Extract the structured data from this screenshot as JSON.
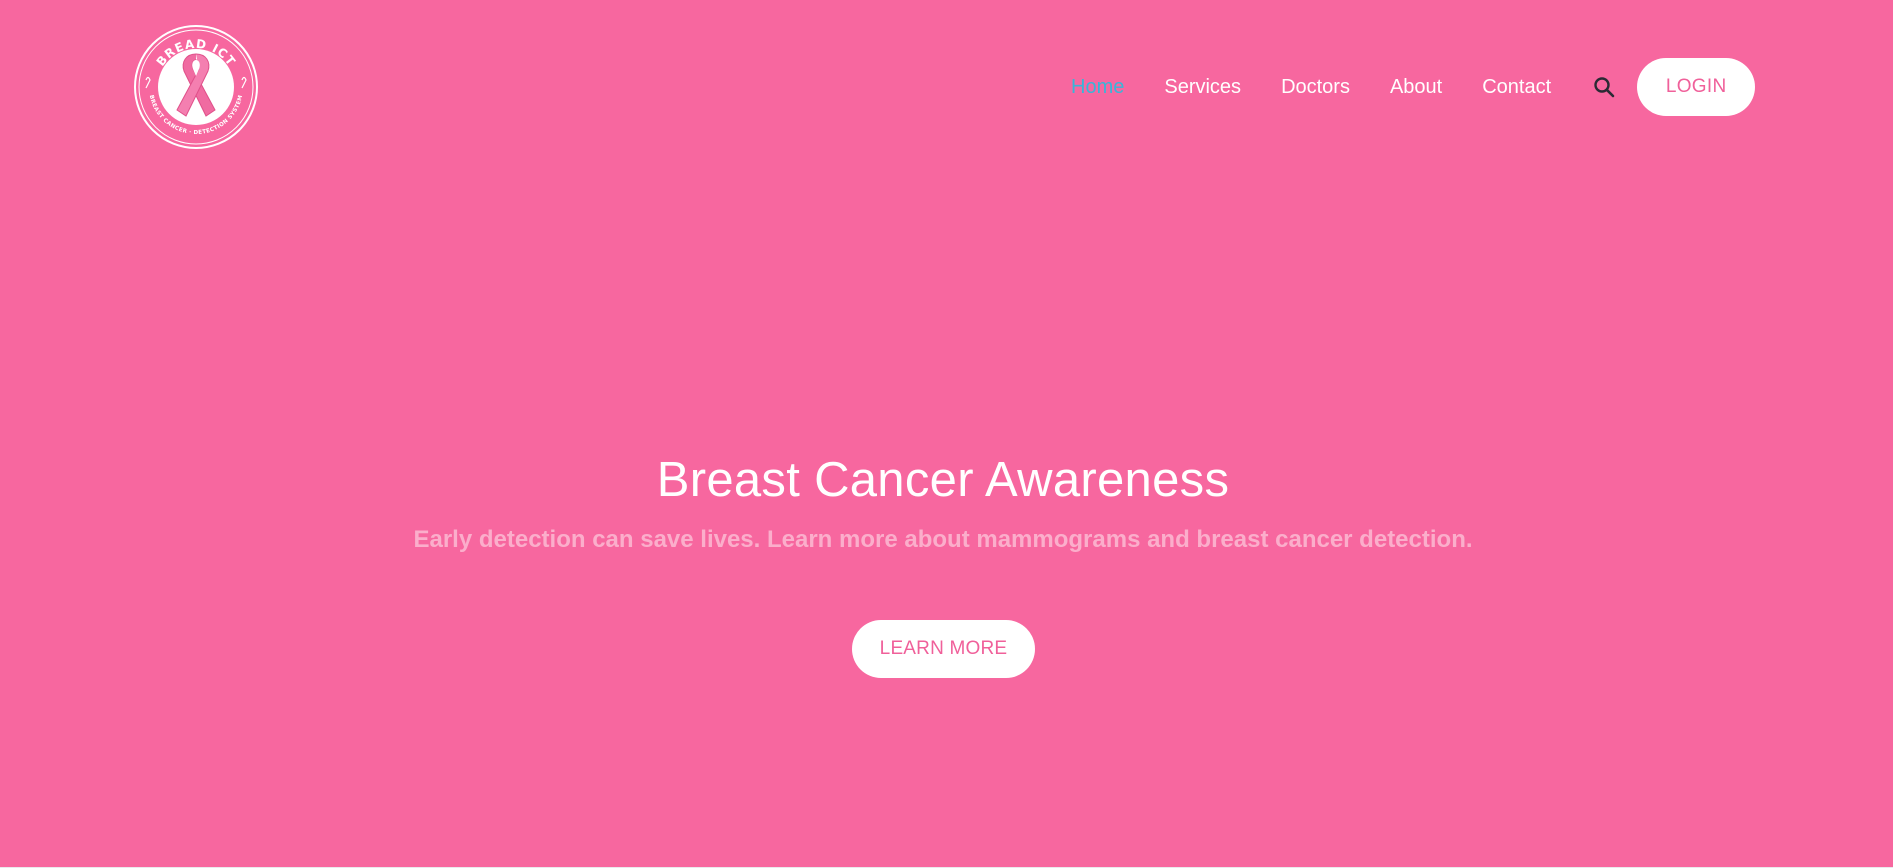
{
  "brand": {
    "logo_top_text": "BREAD ICT",
    "logo_bottom_text": "BREAST CANCER · DETECTION SYSTEM"
  },
  "nav": {
    "items": [
      {
        "label": "Home",
        "active": true
      },
      {
        "label": "Services",
        "active": false
      },
      {
        "label": "Doctors",
        "active": false
      },
      {
        "label": "About",
        "active": false
      },
      {
        "label": "Contact",
        "active": false
      }
    ],
    "search_icon": "search-icon",
    "login_label": "LOGIN"
  },
  "hero": {
    "title": "Breast Cancer Awareness",
    "subtitle": "Early detection can save lives. Learn more about mammograms and breast cancer detection.",
    "cta_label": "LEARN MORE"
  },
  "colors": {
    "background": "#f7679f",
    "active_link": "#38b6d9",
    "button_bg": "#ffffff",
    "button_text": "#f0609a",
    "subtitle": "#fbaecb"
  }
}
